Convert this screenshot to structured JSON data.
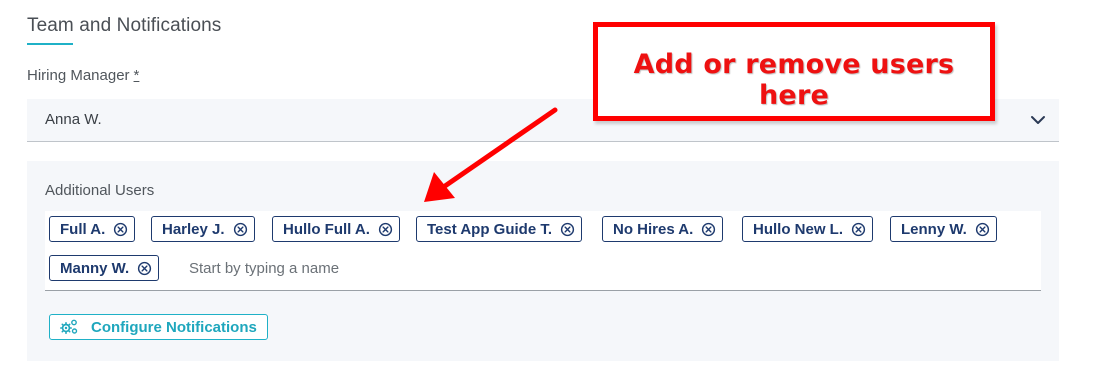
{
  "section": {
    "title": "Team and Notifications"
  },
  "hiring_manager": {
    "label": "Hiring Manager",
    "required_mark": "*",
    "value": "Anna W."
  },
  "additional_users": {
    "label": "Additional Users",
    "chips": [
      {
        "name": "Full A."
      },
      {
        "name": "Harley J."
      },
      {
        "name": "Hullo Full A."
      },
      {
        "name": "Test App Guide T."
      },
      {
        "name": "No Hires A."
      },
      {
        "name": "Hullo New L."
      },
      {
        "name": "Lenny W."
      },
      {
        "name": "Manny W."
      }
    ],
    "input_placeholder": "Start by typing a name"
  },
  "configure_button": {
    "label": "Configure Notifications",
    "icon": "gears-icon"
  },
  "annotation": {
    "text": "Add or remove users here",
    "color": "#ff0000"
  },
  "colors": {
    "accent": "#1fb1c7",
    "chip": "#1e3a6e",
    "panel_bg": "#f5f7fa"
  }
}
